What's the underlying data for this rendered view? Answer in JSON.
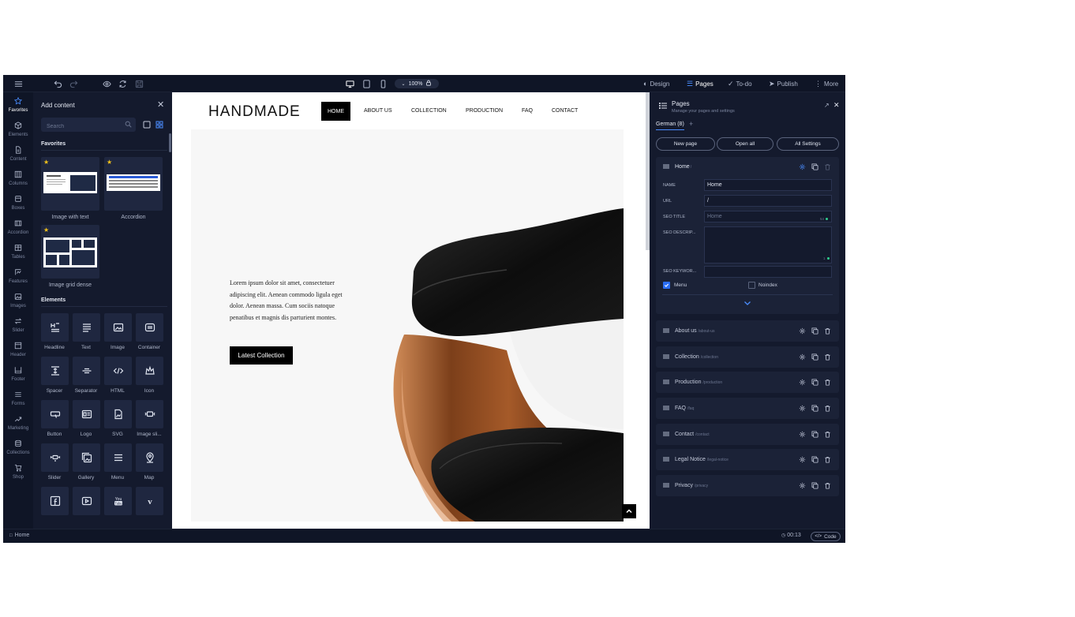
{
  "toolbar": {
    "zoom": "100%",
    "design_label": "Design",
    "pages_label": "Pages",
    "todo_label": "To-do",
    "publish_label": "Publish",
    "more_label": "More"
  },
  "rail": {
    "items": [
      {
        "label": "Favorites",
        "icon": "star-icon",
        "active": true
      },
      {
        "label": "Elements",
        "icon": "cube-icon"
      },
      {
        "label": "Content",
        "icon": "document-icon"
      },
      {
        "label": "Columns",
        "icon": "columns-icon"
      },
      {
        "label": "Boxes",
        "icon": "box-icon"
      },
      {
        "label": "Accordion",
        "icon": "accordion-icon"
      },
      {
        "label": "Tables",
        "icon": "table-icon"
      },
      {
        "label": "Features",
        "icon": "features-icon"
      },
      {
        "label": "Images",
        "icon": "image-icon"
      },
      {
        "label": "Slider",
        "icon": "slider-icon"
      },
      {
        "label": "Header",
        "icon": "header-icon"
      },
      {
        "label": "Footer",
        "icon": "footer-icon"
      },
      {
        "label": "Forms",
        "icon": "forms-icon"
      },
      {
        "label": "Marketing",
        "icon": "marketing-icon"
      },
      {
        "label": "Collections",
        "icon": "collections-icon"
      },
      {
        "label": "Shop",
        "icon": "cart-icon"
      }
    ]
  },
  "add_content": {
    "title": "Add content",
    "search_placeholder": "Search",
    "favorites_heading": "Favorites",
    "elements_heading": "Elements",
    "favorites": [
      "Image with text",
      "Accordion",
      "Image grid dense"
    ],
    "elements": [
      {
        "label": "Headline",
        "icon": "headline-icon"
      },
      {
        "label": "Text",
        "icon": "text-icon"
      },
      {
        "label": "Image",
        "icon": "image-icon"
      },
      {
        "label": "Container",
        "icon": "container-icon"
      },
      {
        "label": "Spacer",
        "icon": "spacer-icon"
      },
      {
        "label": "Separator",
        "icon": "separator-icon"
      },
      {
        "label": "HTML",
        "icon": "code-icon"
      },
      {
        "label": "Icon",
        "icon": "crown-icon"
      },
      {
        "label": "Button",
        "icon": "button-icon"
      },
      {
        "label": "Logo",
        "icon": "logo-icon"
      },
      {
        "label": "SVG",
        "icon": "svg-icon"
      },
      {
        "label": "Image sli...",
        "icon": "image-slider-icon"
      },
      {
        "label": "Slider",
        "icon": "slider-icon"
      },
      {
        "label": "Gallery",
        "icon": "gallery-icon"
      },
      {
        "label": "Menu",
        "icon": "menu-icon"
      },
      {
        "label": "Map",
        "icon": "map-pin-icon"
      },
      {
        "label": "",
        "icon": "facebook-icon"
      },
      {
        "label": "",
        "icon": "video-icon"
      },
      {
        "label": "",
        "icon": "youtube-icon"
      },
      {
        "label": "",
        "icon": "vimeo-icon"
      }
    ]
  },
  "site": {
    "logo": "HANDMADE",
    "nav": [
      "HOME",
      "ABOUT US",
      "COLLECTION",
      "PRODUCTION",
      "FAQ",
      "CONTACT"
    ],
    "hero_text": "Lorem ipsum dolor sit amet, consectetuer adipiscing elit. Aenean commodo ligula eget dolor. Aenean massa. Cum sociis natoque penatibus et magnis dis parturient montes.",
    "hero_button": "Latest Collection"
  },
  "pages_panel": {
    "title": "Pages",
    "subtitle": "Manage your pages and settings",
    "language_tab": "German (8)",
    "buttons": [
      "New page",
      "Open all",
      "All Settings"
    ],
    "home": {
      "name": "Home",
      "url_suffix": "/",
      "fields": {
        "name_label": "NAME",
        "name_value": "Home",
        "url_label": "URL",
        "url_value": "/",
        "seo_title_label": "SEO TITLE",
        "seo_title_placeholder": "Home",
        "seo_title_count": "54",
        "seo_desc_label": "SEO DESCRIP...",
        "seo_desc_count": "1",
        "seo_keywords_label": "SEO KEYWOR...",
        "menu_label": "Menu",
        "noindex_label": "Noindex"
      }
    },
    "pages": [
      {
        "name": "About us",
        "url": "/about-us"
      },
      {
        "name": "Collection",
        "url": "/collection"
      },
      {
        "name": "Production",
        "url": "/production"
      },
      {
        "name": "FAQ",
        "url": "/faq"
      },
      {
        "name": "Contact",
        "url": "/contact"
      },
      {
        "name": "Legal Notice",
        "url": "/legal-notice"
      },
      {
        "name": "Privacy",
        "url": "/privacy"
      }
    ]
  },
  "status": {
    "page": "Home",
    "time": "00:13",
    "code_label": "Code"
  },
  "colors": {
    "accent": "#4a8dff",
    "star": "#f2c21a",
    "app_bg": "#0e1324"
  }
}
